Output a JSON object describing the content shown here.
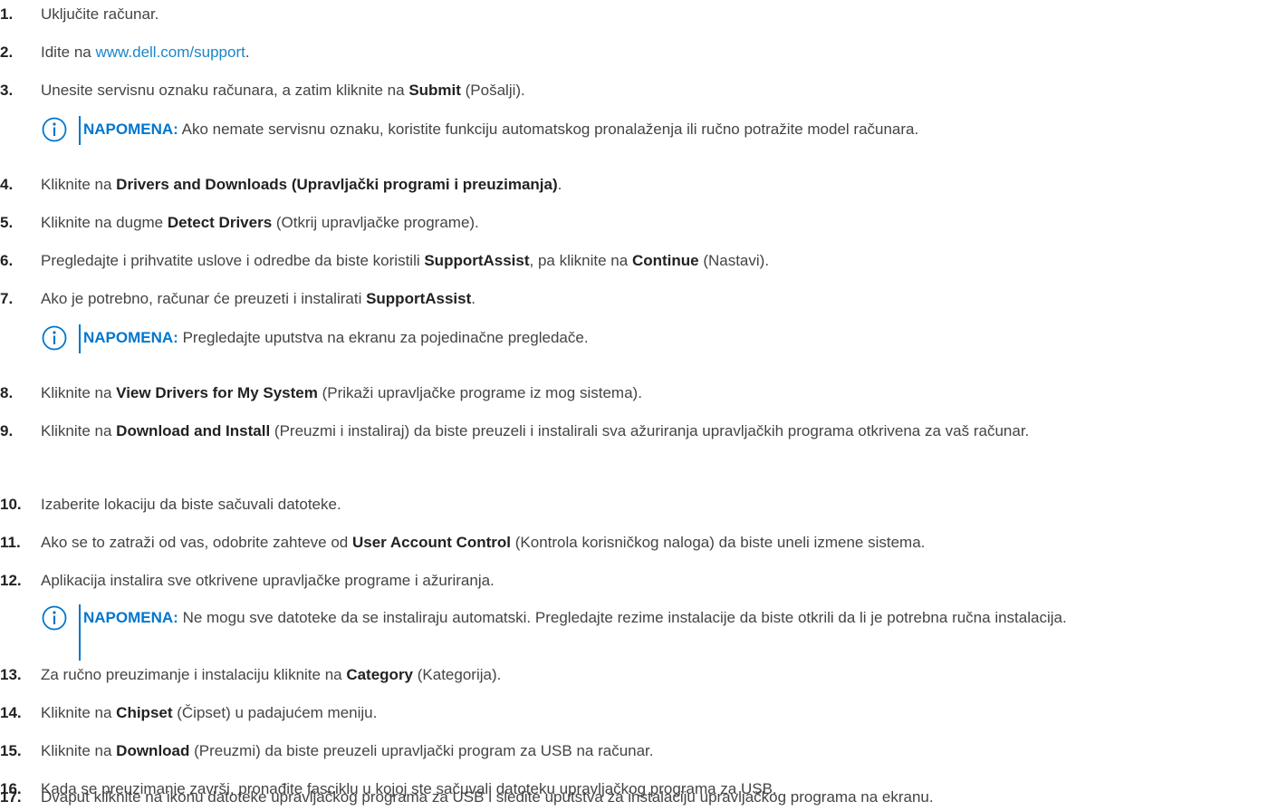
{
  "steps": [
    {
      "num": "1.",
      "parts": [
        {
          "t": "Uključite računar."
        }
      ]
    },
    {
      "num": "2.",
      "parts": [
        {
          "t": "Idite na "
        },
        {
          "t": "www.dell.com/support",
          "link": true
        },
        {
          "t": "."
        }
      ]
    },
    {
      "num": "3.",
      "parts": [
        {
          "t": "Unesite servisnu oznaku računara, a zatim kliknite na "
        },
        {
          "t": "Submit",
          "b": true
        },
        {
          "t": " (Pošalji)."
        }
      ]
    },
    {
      "num": "4.",
      "parts": [
        {
          "t": "Kliknite na "
        },
        {
          "t": "Drivers and Downloads (Upravljački programi i preuzimanja)",
          "b": true
        },
        {
          "t": "."
        }
      ]
    },
    {
      "num": "5.",
      "parts": [
        {
          "t": "Kliknite na dugme "
        },
        {
          "t": "Detect Drivers",
          "b": true
        },
        {
          "t": " (Otkrij upravljačke programe)."
        }
      ]
    },
    {
      "num": "6.",
      "parts": [
        {
          "t": "Pregledajte i prihvatite uslove i odredbe da biste koristili "
        },
        {
          "t": "SupportAssist",
          "b": true
        },
        {
          "t": ", pa kliknite na "
        },
        {
          "t": "Continue",
          "b": true
        },
        {
          "t": " (Nastavi)."
        }
      ]
    },
    {
      "num": "7.",
      "parts": [
        {
          "t": "Ako je potrebno, računar će preuzeti i instalirati "
        },
        {
          "t": "SupportAssist",
          "b": true
        },
        {
          "t": "."
        }
      ]
    },
    {
      "num": "8.",
      "parts": [
        {
          "t": "Kliknite na "
        },
        {
          "t": "View Drivers for My System",
          "b": true
        },
        {
          "t": " (Prikaži upravljačke programe iz mog sistema)."
        }
      ]
    },
    {
      "num": "9.",
      "parts": [
        {
          "t": "Kliknite na "
        },
        {
          "t": "Download and Install",
          "b": true
        },
        {
          "t": " (Preuzmi i instaliraj) da biste preuzeli i instalirali sva ažuriranja upravljačkih programa otkrivena za vaš računar."
        }
      ]
    },
    {
      "num": "10.",
      "parts": [
        {
          "t": "Izaberite lokaciju da biste sačuvali datoteke."
        }
      ]
    },
    {
      "num": "11.",
      "parts": [
        {
          "t": "Ako se to zatraži od vas, odobrite zahteve od "
        },
        {
          "t": "User Account Control",
          "b": true
        },
        {
          "t": " (Kontrola korisničkog naloga) da biste uneli izmene sistema."
        }
      ]
    },
    {
      "num": "12.",
      "parts": [
        {
          "t": "Aplikacija instalira sve otkrivene upravljačke programe i ažuriranja."
        }
      ]
    },
    {
      "num": "13.",
      "parts": [
        {
          "t": "Za ručno preuzimanje i instalaciju kliknite na "
        },
        {
          "t": "Category",
          "b": true
        },
        {
          "t": " (Kategorija)."
        }
      ]
    },
    {
      "num": "14.",
      "parts": [
        {
          "t": "Kliknite na "
        },
        {
          "t": "Chipset",
          "b": true
        },
        {
          "t": " (Čipset) u padajućem meniju."
        }
      ]
    },
    {
      "num": "15.",
      "parts": [
        {
          "t": "Kliknite na "
        },
        {
          "t": "Download",
          "b": true
        },
        {
          "t": " (Preuzmi) da biste preuzeli upravljački program za USB na računar."
        }
      ]
    },
    {
      "num": "16.",
      "parts": [
        {
          "t": "Kada se preuzimanje završi, pronađite fasciklu u kojoj ste sačuvali datoteku upravljačkog programa za USB."
        }
      ]
    },
    {
      "num": "17.",
      "parts": [
        {
          "t": "Dvaput kliknite na ikonu datoteke upravljačkog programa za USB i sledite uputstva za instalaciju upravljačkog programa na ekranu."
        }
      ]
    }
  ],
  "notes": [
    {
      "label": "NAPOMENA:",
      "text": " Ako nemate servisnu oznaku, koristite funkciju automatskog pronalaženja ili ručno potražite model računara."
    },
    {
      "label": "NAPOMENA:",
      "text": " Pregledajte uputstva na ekranu za pojedinačne pregledače."
    },
    {
      "label": "NAPOMENA:",
      "text": " Ne mogu sve datoteke da se instaliraju automatski. Pregledajte rezime instalacije da biste otkrili da li je potrebna ručna instalacija."
    }
  ],
  "colors": {
    "note_accent": "#0076ce",
    "link": "#1a86c9",
    "body_text": "#444444"
  },
  "icons": {
    "note": "info-icon"
  }
}
